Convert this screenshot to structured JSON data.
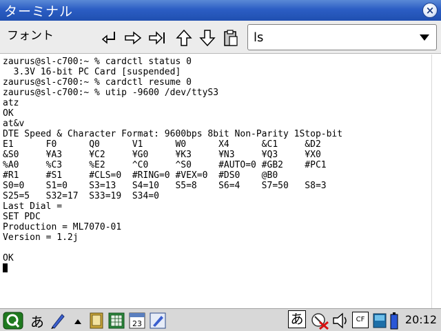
{
  "window": {
    "title": "ターミナル",
    "close_label": "×"
  },
  "toolbar": {
    "font_menu": "フォント",
    "command_value": "ls"
  },
  "terminal": {
    "lines": [
      "zaurus@sl-c700:~ % cardctl status 0",
      "  3.3V 16-bit PC Card [suspended]",
      "zaurus@sl-c700:~ % cardctl resume 0",
      "zaurus@sl-c700:~ % utip -9600 /dev/ttyS3",
      "atz",
      "OK",
      "at&v",
      "DTE Speed & Character Format: 9600bps 8bit Non-Parity 1Stop-bit",
      "E1      F0      Q0      V1      W0      X4      &C1     &D2",
      "&S0     ¥A3     ¥C2     ¥G0     ¥K3     ¥N3     ¥Q3     ¥X0",
      "%A0     %C3     %E2     ^C0     ^S0     #AUTO=0 #GB2    #PC1",
      "#R1     #S1     #CLS=0  #RING=0 #VEX=0  #DS0    @B0",
      "S0=0    S1=0    S3=13   S4=10   S5=8    S6=4    S7=50   S8=3",
      "S25=5   S32=17  S33=19  S34=0",
      "Last Dial =",
      "SET PDC",
      "Production = ML7070-01",
      "Version = 1.2j",
      "",
      "OK"
    ]
  },
  "taskbar": {
    "ime_label": "あ",
    "ime_tray_label": "あ",
    "cf_label": "CF",
    "calendar_label": "23",
    "clock": "20:12"
  },
  "colors": {
    "titlebar": "#2c5ec4",
    "toolbar_bg": "#ececec",
    "taskbar_bg": "#d8d8d8"
  }
}
